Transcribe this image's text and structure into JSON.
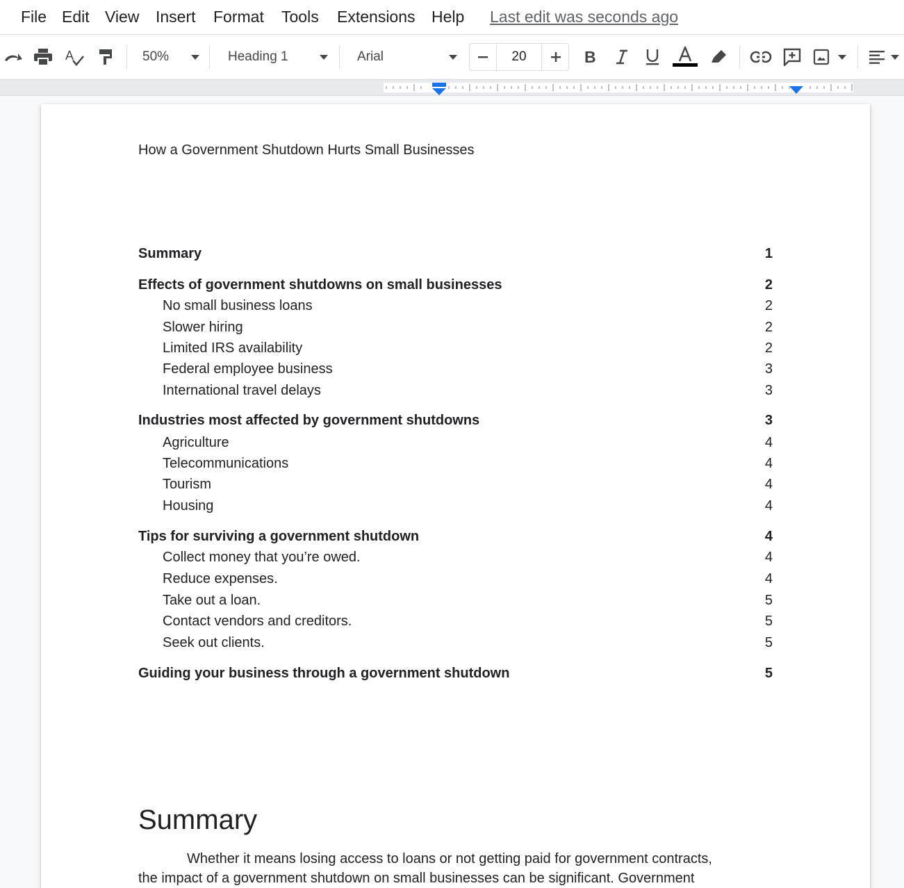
{
  "menu": {
    "file": "File",
    "edit": "Edit",
    "view": "View",
    "insert": "Insert",
    "format": "Format",
    "tools": "Tools",
    "extensions": "Extensions",
    "help": "Help",
    "last_edit": "Last edit was seconds ago"
  },
  "toolbar": {
    "zoom": "50%",
    "style": "Heading 1",
    "font": "Arial",
    "font_size": "20",
    "text_color": "#000000"
  },
  "document": {
    "title": "How a Government Shutdown Hurts Small Businesses",
    "toc": [
      {
        "text": "Summary",
        "page": "1",
        "level": 1
      },
      {
        "text": "Effects of government shutdowns on small businesses",
        "page": "2",
        "level": 1
      },
      {
        "text": "No small business loans",
        "page": "2",
        "level": 2
      },
      {
        "text": "Slower hiring",
        "page": "2",
        "level": 2
      },
      {
        "text": "Limited IRS availability",
        "page": "2",
        "level": 2
      },
      {
        "text": "Federal employee business",
        "page": "3",
        "level": 2
      },
      {
        "text": "International travel delays",
        "page": "3",
        "level": 2
      },
      {
        "text": "Industries most affected by government shutdowns",
        "page": "3",
        "level": 1
      },
      {
        "text": "Agriculture",
        "page": "4",
        "level": 2
      },
      {
        "text": "Telecommunications",
        "page": "4",
        "level": 2
      },
      {
        "text": "Tourism",
        "page": "4",
        "level": 2
      },
      {
        "text": "Housing",
        "page": "4",
        "level": 2
      },
      {
        "text": "Tips for surviving a government shutdown",
        "page": "4",
        "level": 1
      },
      {
        "text": "Collect money that you’re owed.",
        "page": "4",
        "level": 2
      },
      {
        "text": "Reduce expenses.",
        "page": "4",
        "level": 2
      },
      {
        "text": "Take out a loan.",
        "page": "5",
        "level": 2
      },
      {
        "text": "Contact vendors and creditors.",
        "page": "5",
        "level": 2
      },
      {
        "text": "Seek out clients.",
        "page": "5",
        "level": 2
      },
      {
        "text": "Guiding your business through a government shutdown",
        "page": "5",
        "level": 1
      }
    ],
    "section_heading": "Summary",
    "body_line1": "Whether it means losing access to loans or not getting paid for government contracts,",
    "body_line2": "the impact of a government shutdown on small businesses can be significant. Government"
  },
  "colors": {
    "accent": "#1a73e8",
    "toolbar_icon": "#444746"
  }
}
